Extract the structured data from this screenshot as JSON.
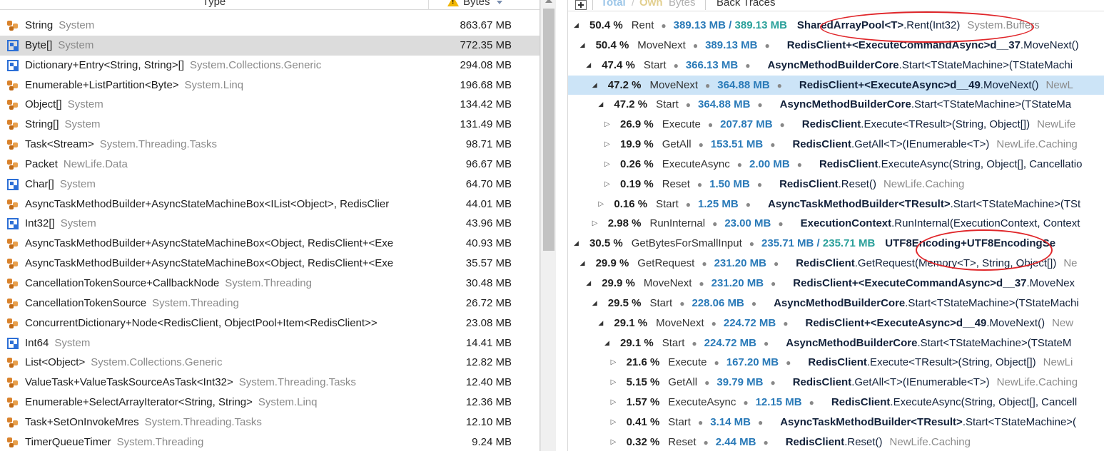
{
  "left": {
    "header": {
      "type_label": "Type",
      "bytes_label": "Bytes"
    },
    "rows": [
      {
        "icon": "class-icon",
        "name": "String",
        "ns": "System",
        "bytes": "863.67 MB"
      },
      {
        "icon": "struct-icon",
        "name": "Byte[]",
        "ns": "System",
        "bytes": "772.35 MB",
        "selected": true
      },
      {
        "icon": "struct-icon",
        "name": "Dictionary+Entry<String, String>[]",
        "ns": "System.Collections.Generic",
        "bytes": "294.08 MB"
      },
      {
        "icon": "class-icon",
        "name": "Enumerable+ListPartition<Byte>",
        "ns": "System.Linq",
        "bytes": "196.68 MB"
      },
      {
        "icon": "class-icon",
        "name": "Object[]",
        "ns": "System",
        "bytes": "134.42 MB"
      },
      {
        "icon": "class-icon",
        "name": "String[]",
        "ns": "System",
        "bytes": "131.49 MB"
      },
      {
        "icon": "class-icon",
        "name": "Task<Stream>",
        "ns": "System.Threading.Tasks",
        "bytes": "98.71 MB"
      },
      {
        "icon": "class-icon",
        "name": "Packet",
        "ns": "NewLife.Data",
        "bytes": "96.67 MB"
      },
      {
        "icon": "struct-icon",
        "name": "Char[]",
        "ns": "System",
        "bytes": "64.70 MB"
      },
      {
        "icon": "class-icon",
        "name": "AsyncTaskMethodBuilder+AsyncStateMachineBox<IList<Object>, RedisClier",
        "ns": "",
        "bytes": "44.01 MB"
      },
      {
        "icon": "struct-icon",
        "name": "Int32[]",
        "ns": "System",
        "bytes": "43.96 MB"
      },
      {
        "icon": "class-icon",
        "name": "AsyncTaskMethodBuilder+AsyncStateMachineBox<Object, RedisClient+<Exe",
        "ns": "",
        "bytes": "40.93 MB"
      },
      {
        "icon": "class-icon",
        "name": "AsyncTaskMethodBuilder+AsyncStateMachineBox<Object, RedisClient+<Exe",
        "ns": "",
        "bytes": "35.57 MB"
      },
      {
        "icon": "class-icon",
        "name": "CancellationTokenSource+CallbackNode",
        "ns": "System.Threading",
        "bytes": "30.48 MB"
      },
      {
        "icon": "class-icon",
        "name": "CancellationTokenSource",
        "ns": "System.Threading",
        "bytes": "26.72 MB"
      },
      {
        "icon": "class-icon",
        "name": "ConcurrentDictionary+Node<RedisClient, ObjectPool+Item<RedisClient>>",
        "ns": "",
        "bytes": "23.08 MB"
      },
      {
        "icon": "struct-icon",
        "name": "Int64",
        "ns": "System",
        "bytes": "14.41 MB"
      },
      {
        "icon": "class-icon",
        "name": "List<Object>",
        "ns": "System.Collections.Generic",
        "bytes": "12.82 MB"
      },
      {
        "icon": "class-icon",
        "name": "ValueTask+ValueTaskSourceAsTask<Int32>",
        "ns": "System.Threading.Tasks",
        "bytes": "12.40 MB"
      },
      {
        "icon": "class-icon",
        "name": "Enumerable+SelectArrayIterator<String, String>",
        "ns": "System.Linq",
        "bytes": "12.36 MB"
      },
      {
        "icon": "class-icon",
        "name": "Task+SetOnInvokeMres",
        "ns": "System.Threading.Tasks",
        "bytes": "12.10 MB"
      },
      {
        "icon": "class-icon",
        "name": "TimerQueueTimer",
        "ns": "System.Threading",
        "bytes": "9.24 MB"
      }
    ]
  },
  "right": {
    "toolbar": {
      "total": "Total",
      "slash": "/",
      "own": "Own",
      "bytes": "Bytes",
      "back_traces": "Back Traces"
    },
    "rows": [
      {
        "level": 0,
        "arrow": "expanded",
        "pct": "50.4 %",
        "method": "Rent",
        "bytes": "389.13 MB",
        "own": "389.13 MB",
        "cls": "SharedArrayPool<T>",
        "sig": ".Rent(Int32)",
        "ns": "System.Buffers"
      },
      {
        "level": 1,
        "arrow": "expanded",
        "pct": "50.4 %",
        "method": "MoveNext",
        "bytes": "389.13 MB",
        "cls": "RedisClient+<ExecuteCommandAsync>d__37",
        "sig": ".MoveNext()",
        "ns": ""
      },
      {
        "level": 2,
        "arrow": "expanded",
        "pct": "47.4 %",
        "method": "Start",
        "bytes": "366.13 MB",
        "cls": "AsyncMethodBuilderCore",
        "sig": ".Start<TStateMachine>(TStateMachi",
        "ns": ""
      },
      {
        "level": 3,
        "arrow": "expanded",
        "pct": "47.2 %",
        "method": "MoveNext",
        "bytes": "364.88 MB",
        "cls": "RedisClient+<ExecuteAsync>d__49",
        "sig": ".MoveNext()",
        "ns": "NewL",
        "selected": true
      },
      {
        "level": 4,
        "arrow": "expanded",
        "pct": "47.2 %",
        "method": "Start",
        "bytes": "364.88 MB",
        "cls": "AsyncMethodBuilderCore",
        "sig": ".Start<TStateMachine>(TStateMa",
        "ns": ""
      },
      {
        "level": 5,
        "arrow": "collapsed",
        "pct": "26.9 %",
        "method": "Execute",
        "bytes": "207.87 MB",
        "cls": "RedisClient",
        "sig": ".Execute<TResult>(String, Object[])",
        "ns": "NewLife"
      },
      {
        "level": 5,
        "arrow": "collapsed",
        "pct": "19.9 %",
        "method": "GetAll",
        "bytes": "153.51 MB",
        "cls": "RedisClient",
        "sig": ".GetAll<T>(IEnumerable<T>)",
        "ns": "NewLife.Caching"
      },
      {
        "level": 5,
        "arrow": "collapsed",
        "pct": "0.26 %",
        "method": "ExecuteAsync",
        "bytes": "2.00 MB",
        "cls": "RedisClient",
        "sig": ".ExecuteAsync(String, Object[], Cancellatio",
        "ns": ""
      },
      {
        "level": 5,
        "arrow": "collapsed",
        "pct": "0.19 %",
        "method": "Reset",
        "bytes": "1.50 MB",
        "cls": "RedisClient",
        "sig": ".Reset()",
        "ns": "NewLife.Caching"
      },
      {
        "level": 4,
        "arrow": "collapsed",
        "pct": "0.16 %",
        "method": "Start",
        "bytes": "1.25 MB",
        "cls": "AsyncTaskMethodBuilder<TResult>",
        "sig": ".Start<TStateMachine>(TSt",
        "ns": ""
      },
      {
        "level": 3,
        "arrow": "collapsed",
        "pct": "2.98 %",
        "method": "RunInternal",
        "bytes": "23.00 MB",
        "cls": "ExecutionContext",
        "sig": ".RunInternal(ExecutionContext, Context",
        "ns": ""
      },
      {
        "level": 0,
        "arrow": "expanded",
        "pct": "30.5 %",
        "method": "GetBytesForSmallInput",
        "bytes": "235.71 MB",
        "own": "235.71 MB",
        "cls": "UTF8Encoding+UTF8EncodingSe",
        "sig": "",
        "ns": ""
      },
      {
        "level": 1,
        "arrow": "expanded",
        "pct": "29.9 %",
        "method": "GetRequest",
        "bytes": "231.20 MB",
        "cls": "RedisClient",
        "sig": ".GetRequest(Memory<T>, String, Object[])",
        "ns": "Ne"
      },
      {
        "level": 2,
        "arrow": "expanded",
        "pct": "29.9 %",
        "method": "MoveNext",
        "bytes": "231.20 MB",
        "cls": "RedisClient+<ExecuteCommandAsync>d__37",
        "sig": ".MoveNex",
        "ns": ""
      },
      {
        "level": 3,
        "arrow": "expanded",
        "pct": "29.5 %",
        "method": "Start",
        "bytes": "228.06 MB",
        "cls": "AsyncMethodBuilderCore",
        "sig": ".Start<TStateMachine>(TStateMachi",
        "ns": ""
      },
      {
        "level": 4,
        "arrow": "expanded",
        "pct": "29.1 %",
        "method": "MoveNext",
        "bytes": "224.72 MB",
        "cls": "RedisClient+<ExecuteAsync>d__49",
        "sig": ".MoveNext()",
        "ns": "New"
      },
      {
        "level": 5,
        "arrow": "expanded",
        "pct": "29.1 %",
        "method": "Start",
        "bytes": "224.72 MB",
        "cls": "AsyncMethodBuilderCore",
        "sig": ".Start<TStateMachine>(TStateM",
        "ns": ""
      },
      {
        "level": 6,
        "arrow": "collapsed",
        "pct": "21.6 %",
        "method": "Execute",
        "bytes": "167.20 MB",
        "cls": "RedisClient",
        "sig": ".Execute<TResult>(String, Object[])",
        "ns": "NewLi"
      },
      {
        "level": 6,
        "arrow": "collapsed",
        "pct": "5.15 %",
        "method": "GetAll",
        "bytes": "39.79 MB",
        "cls": "RedisClient",
        "sig": ".GetAll<T>(IEnumerable<T>)",
        "ns": "NewLife.Caching"
      },
      {
        "level": 6,
        "arrow": "collapsed",
        "pct": "1.57 %",
        "method": "ExecuteAsync",
        "bytes": "12.15 MB",
        "cls": "RedisClient",
        "sig": ".ExecuteAsync(String, Object[], Cancell",
        "ns": ""
      },
      {
        "level": 6,
        "arrow": "collapsed",
        "pct": "0.41 %",
        "method": "Start",
        "bytes": "3.14 MB",
        "cls": "AsyncTaskMethodBuilder<TResult>",
        "sig": ".Start<TStateMachine>(",
        "ns": ""
      },
      {
        "level": 6,
        "arrow": "collapsed",
        "pct": "0.32 %",
        "method": "Reset",
        "bytes": "2.44 MB",
        "cls": "RedisClient",
        "sig": ".Reset()",
        "ns": "NewLife.Caching"
      }
    ]
  },
  "colors": {
    "bytes_blue": "#2a7ab8",
    "own_teal": "#2aa09a",
    "highlight_red": "#e0262a",
    "selected_left": "#dcdcdc",
    "selected_right": "#cce4f7",
    "class_icon": "#d9822b",
    "struct_icon": "#2c6fd6"
  }
}
